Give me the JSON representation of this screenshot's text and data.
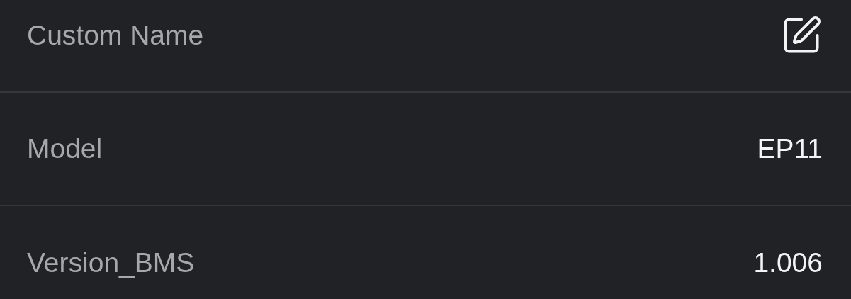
{
  "rows": [
    {
      "kind": "edit",
      "label": "Custom Name"
    },
    {
      "kind": "value",
      "label": "Model",
      "value": "EP11"
    },
    {
      "kind": "value",
      "label": "Version_BMS",
      "value": "1.006"
    }
  ]
}
